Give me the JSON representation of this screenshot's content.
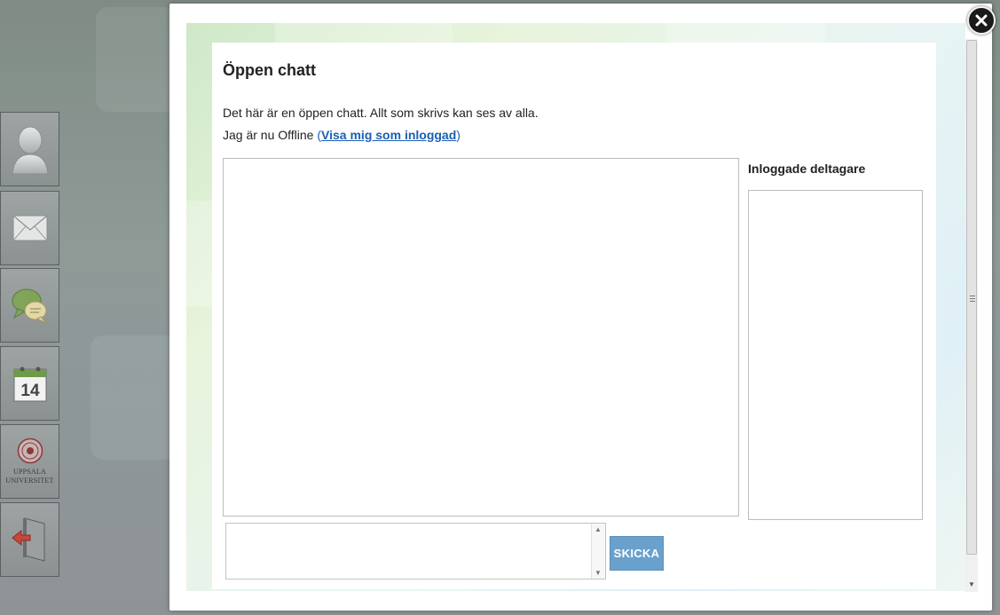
{
  "chat": {
    "title": "Öppen chatt",
    "description": "Det här är en öppen chatt. Allt som skrivs kan ses av alla.",
    "status_prefix": "Jag är nu Offline ",
    "status_link_open": "(",
    "status_link": "Visa mig som inloggad",
    "status_link_close": ")",
    "participants_title": "Inloggade deltagare",
    "message_value": "",
    "send_label": "SKICKA"
  },
  "sidebar": {
    "items": [
      {
        "name": "profile",
        "icon": "user-icon"
      },
      {
        "name": "messages",
        "icon": "envelope-icon"
      },
      {
        "name": "chat",
        "icon": "chat-bubbles-icon"
      },
      {
        "name": "calendar",
        "icon": "calendar-icon",
        "label": "14"
      },
      {
        "name": "uppsala",
        "icon": "uppsala-seal-icon",
        "label_line1": "UPPSALA",
        "label_line2": "UNIVERSITET"
      },
      {
        "name": "logout",
        "icon": "logout-door-icon"
      }
    ]
  },
  "colors": {
    "send_button": "#6aa0cc",
    "link": "#1a5fb4",
    "close_button": "#1a1a1a"
  }
}
